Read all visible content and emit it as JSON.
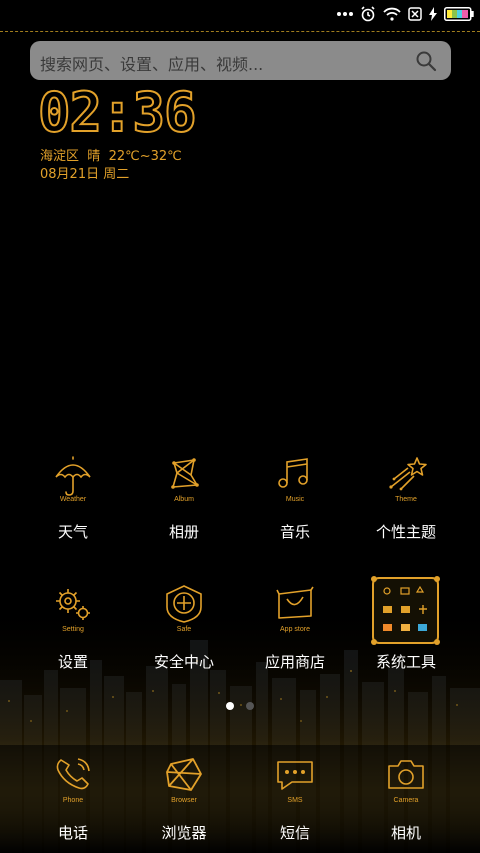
{
  "colors": {
    "accent": "#e2a12a",
    "background": "#000000",
    "search_bg": "#8b8b8b",
    "label": "#ffffff"
  },
  "status_bar": {
    "icons": [
      "more-dots-icon",
      "alarm-icon",
      "wifi-icon",
      "no-sim-icon",
      "charging-icon",
      "battery-icon"
    ]
  },
  "search": {
    "placeholder": "搜索网页、设置、应用、视频..."
  },
  "clock": {
    "time": "02:36",
    "location": "海淀区",
    "condition": "晴",
    "temperature": "22℃~32℃",
    "date": "08月21日",
    "weekday": "周二"
  },
  "apps": [
    {
      "label": "天气",
      "caption": "Weather",
      "icon": "umbrella-icon"
    },
    {
      "label": "相册",
      "caption": "Album",
      "icon": "album-icon"
    },
    {
      "label": "音乐",
      "caption": "Music",
      "icon": "music-note-icon"
    },
    {
      "label": "个性主题",
      "caption": "Theme",
      "icon": "shooting-star-icon"
    },
    {
      "label": "设置",
      "caption": "Setting",
      "icon": "gear-icon"
    },
    {
      "label": "安全中心",
      "caption": "Safe",
      "icon": "shield-plus-icon"
    },
    {
      "label": "应用商店",
      "caption": "App store",
      "icon": "shopping-bag-icon"
    },
    {
      "label": "系统工具",
      "caption": "",
      "icon": "folder-icon"
    }
  ],
  "page_indicator": {
    "current_page": 1,
    "total_pages": 2
  },
  "dock": [
    {
      "label": "电话",
      "caption": "Phone",
      "icon": "phone-icon"
    },
    {
      "label": "浏览器",
      "caption": "Browser",
      "icon": "browser-icon"
    },
    {
      "label": "短信",
      "caption": "SMS",
      "icon": "sms-icon"
    },
    {
      "label": "相机",
      "caption": "Camera",
      "icon": "camera-icon"
    }
  ]
}
